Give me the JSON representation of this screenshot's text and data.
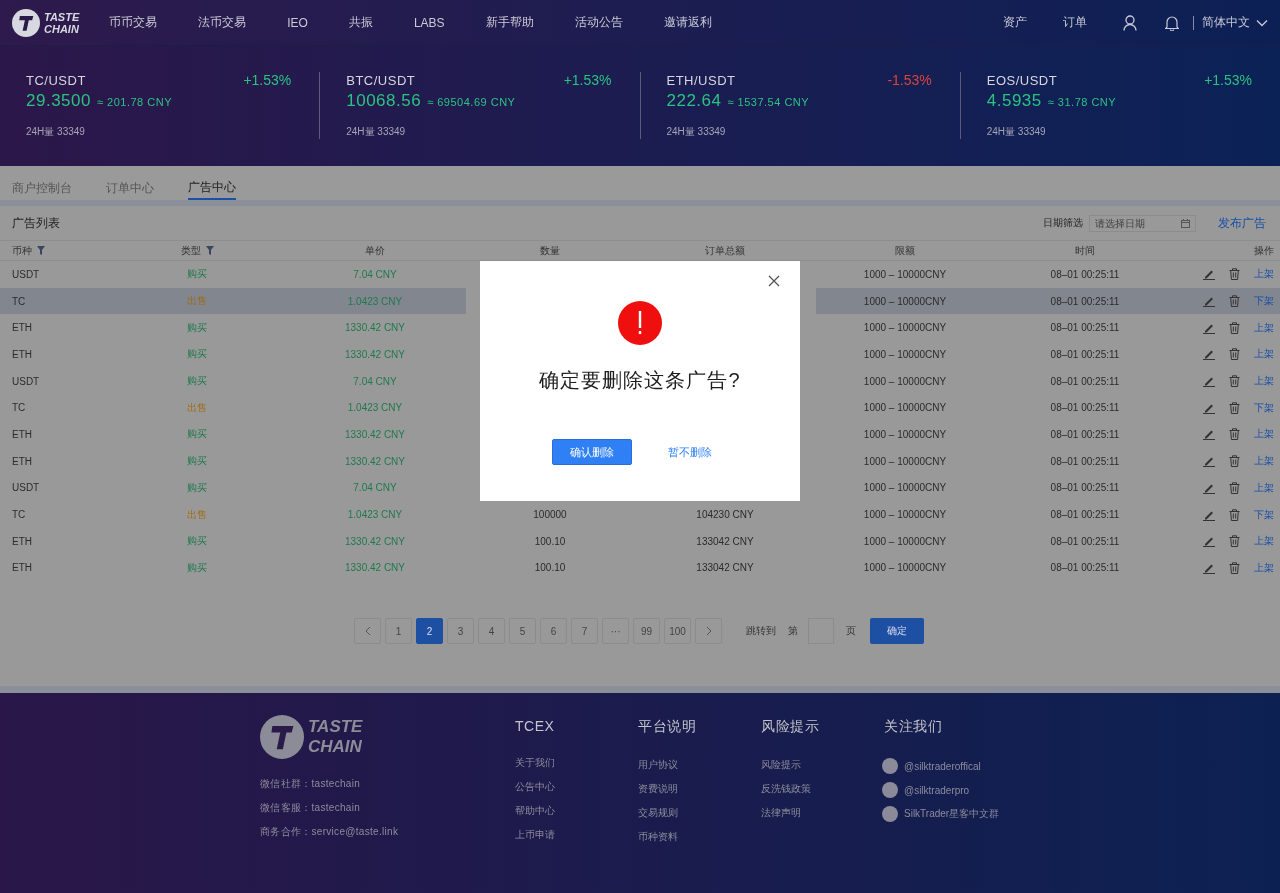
{
  "nav": {
    "logo": [
      "TASTE",
      "CHAIN"
    ],
    "items": [
      "币币交易",
      "法币交易",
      "IEO",
      "共振",
      "LABS",
      "新手帮助",
      "活动公告",
      "邀请返利"
    ],
    "right": [
      "资产",
      "订单"
    ],
    "language": "简体中文"
  },
  "tickers": [
    {
      "pair": "TC/USDT",
      "change": "+1.53%",
      "color": "#2bc280",
      "price": "29.3500",
      "cny": "≈ 201.78 CNY",
      "volume": "24H量 33349"
    },
    {
      "pair": "BTC/USDT",
      "change": "+1.53%",
      "color": "#2bc280",
      "price": "10068.56",
      "cny": "≈ 69504.69 CNY",
      "volume": "24H量 33349"
    },
    {
      "pair": "ETH/USDT",
      "change": "-1.53%",
      "color": "#d9453b",
      "price": "222.64",
      "cny": "≈ 1537.54 CNY",
      "volume": "24H量 33349"
    },
    {
      "pair": "EOS/USDT",
      "change": "+1.53%",
      "color": "#2bc280",
      "price": "4.5935",
      "cny": "≈ 31.78 CNY",
      "volume": "24H量 33349"
    }
  ],
  "tabs": [
    {
      "label": "商户控制台",
      "selected": false
    },
    {
      "label": "订单中心",
      "selected": false
    },
    {
      "label": "广告中心",
      "selected": true
    }
  ],
  "ad_list": {
    "title": "广告列表",
    "date_filter": {
      "label": "日期筛选",
      "placeholder": "请选择日期"
    },
    "publish": "发布广告",
    "columns": [
      {
        "label": "币种",
        "filter": true
      },
      {
        "label": "类型",
        "filter": true
      },
      {
        "label": "单价",
        "filter": false
      },
      {
        "label": "数量",
        "filter": false
      },
      {
        "label": "订单总额",
        "filter": false
      },
      {
        "label": "限额",
        "filter": false
      },
      {
        "label": "时间",
        "filter": false
      },
      {
        "label": "操作",
        "filter": false
      }
    ],
    "rows": [
      {
        "coin": "USDT",
        "type": "购买",
        "kind": "buy",
        "price": "7.04 CNY",
        "limit": "1000 – 10000CNY",
        "time": "08–01 00:25:11",
        "action": "上架",
        "selected": false
      },
      {
        "coin": "TC",
        "type": "出售",
        "kind": "sell",
        "price": "1.0423 CNY",
        "limit": "1000 – 10000CNY",
        "time": "08–01 00:25:11",
        "action": "下架",
        "selected": true
      },
      {
        "coin": "ETH",
        "type": "购买",
        "kind": "buy",
        "price": "1330.42 CNY",
        "limit": "1000 – 10000CNY",
        "time": "08–01 00:25:11",
        "action": "上架",
        "selected": false
      },
      {
        "coin": "ETH",
        "type": "购买",
        "kind": "buy",
        "price": "1330.42 CNY",
        "limit": "1000 – 10000CNY",
        "time": "08–01 00:25:11",
        "action": "上架",
        "selected": false
      },
      {
        "coin": "USDT",
        "type": "购买",
        "kind": "buy",
        "price": "7.04 CNY",
        "limit": "1000 – 10000CNY",
        "time": "08–01 00:25:11",
        "action": "上架",
        "selected": false
      },
      {
        "coin": "TC",
        "type": "出售",
        "kind": "sell",
        "price": "1.0423 CNY",
        "limit": "1000 – 10000CNY",
        "time": "08–01 00:25:11",
        "action": "下架",
        "selected": false
      },
      {
        "coin": "ETH",
        "type": "购买",
        "kind": "buy",
        "price": "1330.42 CNY",
        "limit": "1000 – 10000CNY",
        "time": "08–01 00:25:11",
        "action": "上架",
        "selected": false
      },
      {
        "coin": "ETH",
        "type": "购买",
        "kind": "buy",
        "price": "1330.42 CNY",
        "limit": "1000 – 10000CNY",
        "time": "08–01 00:25:11",
        "action": "上架",
        "selected": false
      },
      {
        "coin": "USDT",
        "type": "购买",
        "kind": "buy",
        "price": "7.04 CNY",
        "limit": "1000 – 10000CNY",
        "time": "08–01 00:25:11",
        "action": "上架",
        "selected": false
      },
      {
        "coin": "TC",
        "type": "出售",
        "kind": "sell",
        "price": "1.0423 CNY",
        "quantity": "100000",
        "total": "104230 CNY",
        "limit": "1000 – 10000CNY",
        "time": "08–01 00:25:11",
        "action": "下架",
        "selected": false
      },
      {
        "coin": "ETH",
        "type": "购买",
        "kind": "buy",
        "price": "1330.42 CNY",
        "quantity": "100.10",
        "total": "133042 CNY",
        "limit": "1000 – 10000CNY",
        "time": "08–01 00:25:11",
        "action": "上架",
        "selected": false
      },
      {
        "coin": "ETH",
        "type": "购买",
        "kind": "buy",
        "price": "1330.42 CNY",
        "quantity": "100.10",
        "total": "133042 CNY",
        "limit": "1000 – 10000CNY",
        "time": "08–01 00:25:11",
        "action": "上架",
        "selected": false
      }
    ]
  },
  "pagination": {
    "pages": [
      {
        "label": "1",
        "selected": false
      },
      {
        "label": "2",
        "selected": true
      },
      {
        "label": "3",
        "selected": false
      },
      {
        "label": "4",
        "selected": false
      },
      {
        "label": "5",
        "selected": false
      },
      {
        "label": "6",
        "selected": false
      },
      {
        "label": "7",
        "selected": false
      },
      {
        "label": "···",
        "selected": false
      },
      {
        "label": "99",
        "selected": false
      },
      {
        "label": "100",
        "selected": false
      }
    ],
    "jump_label": "跳转到",
    "page_prefix": "第",
    "page_suffix": "页",
    "confirm": "确定"
  },
  "dialog": {
    "message": "确定要删除这条广告?",
    "confirm": "确认删除",
    "cancel": "暂不删除"
  },
  "footer": {
    "logo": [
      "TASTE",
      "CHAIN"
    ],
    "contacts": [
      "微信社群：tastechain",
      "微信客服：tastechain",
      "商务合作：service@taste.link"
    ],
    "columns": [
      {
        "title": "TCEX",
        "links": [
          "关于我们",
          "公告中心",
          "帮助中心",
          "上币申请"
        ]
      },
      {
        "title": "平台说明",
        "links": [
          "用户协议",
          "资费说明",
          "交易规则",
          "币种资料"
        ]
      },
      {
        "title": "风险提示",
        "links": [
          "风险提示",
          "反洗钱政策",
          "法律声明"
        ]
      }
    ],
    "follow": {
      "title": "关注我们",
      "items": [
        "@silktraderoffical",
        "@silktraderpro",
        "SilkTrader星客中文群"
      ]
    }
  }
}
